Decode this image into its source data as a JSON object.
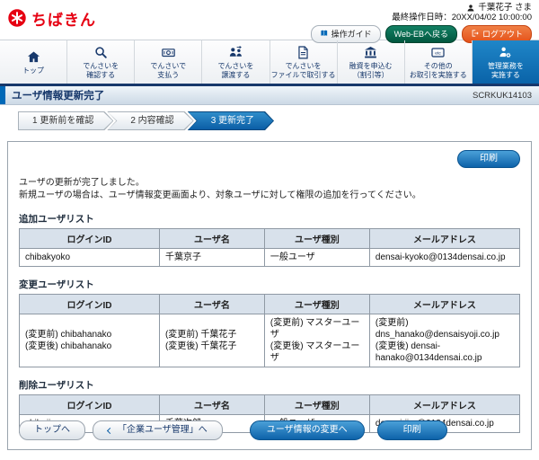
{
  "colors": {
    "brand_red": "#e60012",
    "accent_blue": "#0068b7",
    "nav_navy": "#17386b",
    "logout_orange": "#ea5514",
    "webeb_green": "#0a6a4f"
  },
  "header": {
    "logo_text": "ちばきん",
    "user_name": "千葉花子 さま",
    "last_operation": "最終操作日時：20XX/04/02 10:00:00",
    "buttons": {
      "guide": "操作ガイド",
      "web_eb": "Web-EBへ戻る",
      "logout": "ログアウト"
    }
  },
  "nav": {
    "items": [
      {
        "label": "トップ",
        "icon": "home-icon"
      },
      {
        "label": "でんさいを\n確認する",
        "icon": "search-icon"
      },
      {
        "label": "でんさいで\n支払う",
        "icon": "payment-icon"
      },
      {
        "label": "でんさいを\n譲渡する",
        "icon": "transfer-icon"
      },
      {
        "label": "でんさいを\nファイルで取引する",
        "icon": "file-icon"
      },
      {
        "label": "融資を申込む\n（割引等）",
        "icon": "bank-icon"
      },
      {
        "label": "その他の\nお取引を実施する",
        "icon": "etc-icon",
        "icon_text": "etc"
      },
      {
        "label": "管理業務を\n実施する",
        "icon": "admin-gear-icon",
        "active": true
      }
    ]
  },
  "page": {
    "title": "ユーザ情報更新完了",
    "screen_id": "SCRKUK14103",
    "steps": [
      {
        "label": "1 更新前を確認",
        "active": false
      },
      {
        "label": "2 内容確認",
        "active": false
      },
      {
        "label": "3 更新完了",
        "active": true
      }
    ]
  },
  "main": {
    "print_button": "印刷",
    "message_line1": "ユーザの更新が完了しました。",
    "message_line2": "新規ユーザの場合は、ユーザ情報変更画面より、対象ユーザに対して権限の追加を行ってください。"
  },
  "tables": {
    "headers": [
      "ログインID",
      "ユーザ名",
      "ユーザ種別",
      "メールアドレス"
    ],
    "added": {
      "title": "追加ユーザリスト",
      "rows": [
        [
          "chibakyoko",
          "千葉京子",
          "一般ユーザ",
          "densai-kyoko@0134densai.co.jp"
        ]
      ]
    },
    "changed": {
      "title": "変更ユーザリスト",
      "rows": [
        [
          "(変更前) chibahanako\n(変更後) chibahanako",
          "(変更前) 千葉花子\n(変更後) 千葉花子",
          "(変更前) マスターユーザ\n(変更後) マスターユーザ",
          "(変更前) dns_hanako@densaisyoji.co.jp\n(変更後) densai-hanako@0134densai.co.jp"
        ]
      ]
    },
    "deleted": {
      "title": "削除ユーザリスト",
      "rows": [
        [
          "chibajiro",
          "千葉次郎",
          "一般ユーザ",
          "densai-jiro@0134densai.co.jp"
        ]
      ]
    }
  },
  "footer": {
    "top_button": "トップへ",
    "corporate_button": "「企業ユーザ管理」へ",
    "change_button": "ユーザ情報の変更へ",
    "print_button": "印刷"
  }
}
